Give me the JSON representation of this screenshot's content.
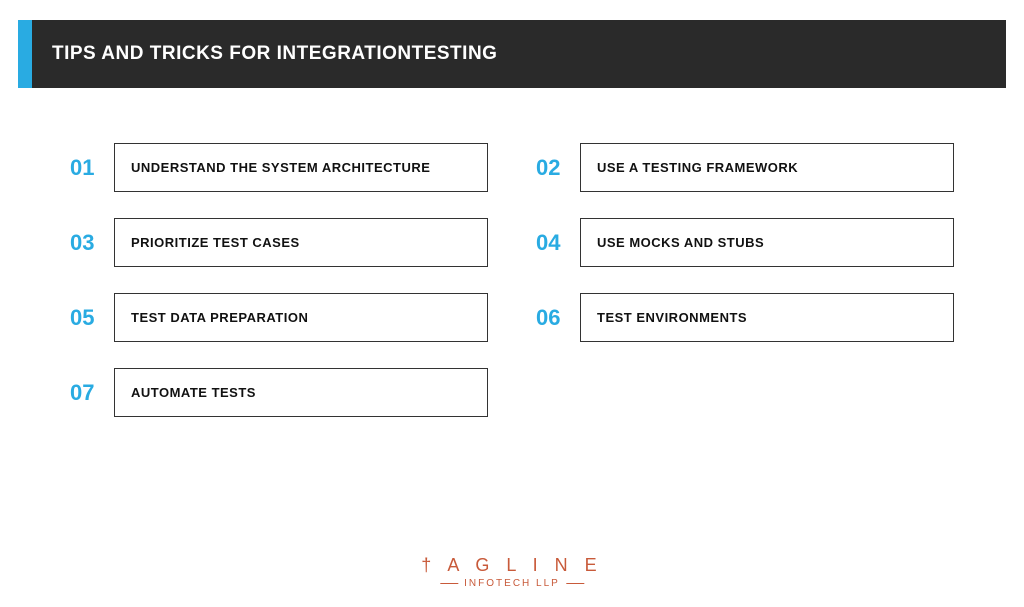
{
  "header": {
    "title": "TIPS AND TRICKS FOR INTEGRATIONTESTING"
  },
  "tips": [
    {
      "num": "01",
      "label": "UNDERSTAND THE SYSTEM ARCHITECTURE"
    },
    {
      "num": "02",
      "label": "USE A TESTING FRAMEWORK"
    },
    {
      "num": "03",
      "label": "PRIORITIZE TEST CASES"
    },
    {
      "num": "04",
      "label": "USE MOCKS AND STUBS"
    },
    {
      "num": "05",
      "label": "TEST DATA PREPARATION"
    },
    {
      "num": "06",
      "label": "TEST ENVIRONMENTS"
    },
    {
      "num": "07",
      "label": "AUTOMATE TESTS"
    }
  ],
  "footer": {
    "logo_top": "† A G L I N E",
    "logo_bottom": "INFOTECH LLP"
  },
  "colors": {
    "accent": "#29abe2",
    "header_bg": "#2a2a2a",
    "logo": "#c85a3a"
  }
}
